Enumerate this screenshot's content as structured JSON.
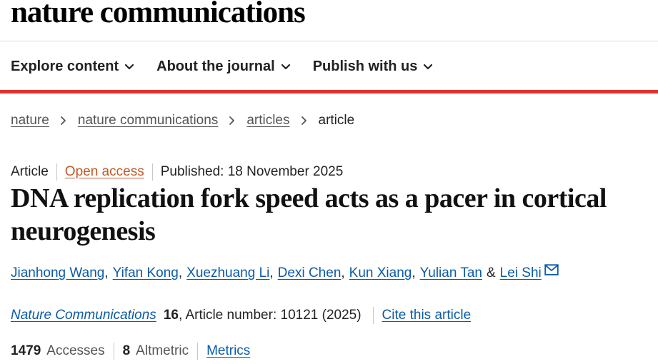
{
  "site": {
    "logo": "nature communications"
  },
  "nav": {
    "items": [
      {
        "label": "Explore content"
      },
      {
        "label": "About the journal"
      },
      {
        "label": "Publish with us"
      }
    ]
  },
  "breadcrumb": {
    "links": [
      "nature",
      "nature communications",
      "articles"
    ],
    "current": "article"
  },
  "article": {
    "type": "Article",
    "access": "Open access",
    "published": "Published: 18 November 2025",
    "title": "DNA replication fork speed acts as a pacer in cortical neurogenesis",
    "authors": [
      "Jianhong Wang",
      "Yifan Kong",
      "Xuezhuang Li",
      "Dexi Chen",
      "Kun Xiang",
      "Yulian Tan"
    ],
    "last_author": "Lei Shi",
    "author_separator": "&",
    "citation": {
      "journal": "Nature Communications",
      "volume": "16",
      "details": ", Article number: 10121 (2025)",
      "cite_label": "Cite this article"
    },
    "metrics": {
      "accesses_count": "1479",
      "accesses_label": "Accesses",
      "altmetric_count": "8",
      "altmetric_label": "Altmetric",
      "metrics_link": "Metrics"
    }
  },
  "icons": {
    "nav_chevron": "chevron-down-icon",
    "breadcrumb_sep": "chevron-right-icon",
    "author_contact": "mail-icon"
  },
  "colors": {
    "accent_red": "#e0332d",
    "link_blue": "#0b5aa7",
    "open_access_orange": "#c05a2b"
  }
}
